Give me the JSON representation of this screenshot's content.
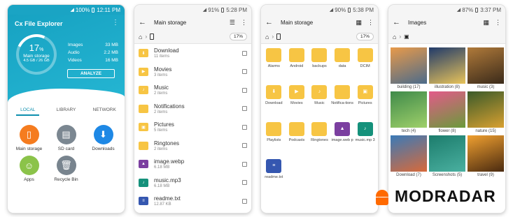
{
  "status": [
    {
      "battery": "100%",
      "time": "12:11 PM"
    },
    {
      "battery": "91%",
      "time": "5:28 PM"
    },
    {
      "battery": "90%",
      "time": "5:38 PM"
    },
    {
      "battery": "87%",
      "time": "3:37 PM"
    }
  ],
  "home": {
    "app_title": "Cx File Explorer",
    "percent": "17",
    "percent_sign": "%",
    "storage_label": "Main storage",
    "storage_size": "4.5 GB / 26 GB",
    "usage_progress": 0.17,
    "stats": [
      {
        "label": "Images",
        "value": "33 MB"
      },
      {
        "label": "Audio",
        "value": "2.2 MB"
      },
      {
        "label": "Videos",
        "value": "16 MB"
      }
    ],
    "analyze_label": "ANALYZE",
    "tabs": [
      "LOCAL",
      "LIBRARY",
      "NETWORK"
    ],
    "categories": [
      {
        "label": "Main storage",
        "color": "#f57c1f",
        "icon": "phone-icon"
      },
      {
        "label": "SD card",
        "color": "#7b8791",
        "icon": "sd-card-icon"
      },
      {
        "label": "Downloads",
        "color": "#1e88e5",
        "icon": "download-icon"
      },
      {
        "label": "Apps",
        "color": "#8bc34a",
        "icon": "android-icon"
      },
      {
        "label": "Recycle Bin",
        "color": "#78848e",
        "icon": "trash-icon"
      }
    ]
  },
  "list_view": {
    "title": "Main storage",
    "usage_chip": "17%",
    "items": [
      {
        "name": "Download",
        "sub": "11 items",
        "icon": "download-folder-icon"
      },
      {
        "name": "Movies",
        "sub": "3 items",
        "icon": "movies-folder-icon"
      },
      {
        "name": "Music",
        "sub": "2 items",
        "icon": "music-folder-icon"
      },
      {
        "name": "Notifications",
        "sub": "2 items",
        "icon": "folder-icon"
      },
      {
        "name": "Pictures",
        "sub": "5 items",
        "icon": "pictures-folder-icon"
      },
      {
        "name": "Ringtones",
        "sub": "2 items",
        "icon": "folder-icon"
      },
      {
        "name": "image.webp",
        "sub": "6.18 MB",
        "icon": "image-file-icon"
      },
      {
        "name": "music.mp3",
        "sub": "6.18 MB",
        "icon": "audio-file-icon"
      },
      {
        "name": "readme.txt",
        "sub": "12.87 KB",
        "icon": "text-file-icon"
      }
    ]
  },
  "grid_view": {
    "title": "Main storage",
    "usage_chip": "17%",
    "items": [
      {
        "name": "Alarms",
        "kind": "folder"
      },
      {
        "name": "Android",
        "kind": "folder"
      },
      {
        "name": "backups",
        "kind": "folder"
      },
      {
        "name": "data",
        "kind": "folder"
      },
      {
        "name": "DCIM",
        "kind": "folder"
      },
      {
        "name": "Download",
        "kind": "folder",
        "glyph": "⬇"
      },
      {
        "name": "Movies",
        "kind": "folder",
        "glyph": "▶"
      },
      {
        "name": "Music",
        "kind": "folder",
        "glyph": "♪"
      },
      {
        "name": "Notifica-tions",
        "kind": "folder"
      },
      {
        "name": "Pictures",
        "kind": "folder",
        "glyph": "▣"
      },
      {
        "name": "Playlists",
        "kind": "folder"
      },
      {
        "name": "Podcasts",
        "kind": "folder"
      },
      {
        "name": "Ringtones",
        "kind": "folder"
      },
      {
        "name": "image.web p",
        "kind": "image"
      },
      {
        "name": "music.mp 3",
        "kind": "audio"
      },
      {
        "name": "readme.txt",
        "kind": "text"
      }
    ]
  },
  "images_view": {
    "title": "Images",
    "items": [
      {
        "label": "building (17)",
        "colors": [
          "#e89a4a",
          "#4c6b8a"
        ]
      },
      {
        "label": "illustration (8)",
        "colors": [
          "#203a6a",
          "#e8c35a"
        ]
      },
      {
        "label": "music (3)",
        "colors": [
          "#b07a3a",
          "#3a2a1a"
        ]
      },
      {
        "label": "tech (4)",
        "colors": [
          "#3f8a4a",
          "#9fd06a"
        ]
      },
      {
        "label": "flower (8)",
        "colors": [
          "#e35a8a",
          "#6a9a3a"
        ]
      },
      {
        "label": "nature (15)",
        "colors": [
          "#3a5a2a",
          "#d8a030"
        ]
      },
      {
        "label": "Download (7)",
        "colors": [
          "#3a7ab8",
          "#d86a3a"
        ]
      },
      {
        "label": "Screenshots (5)",
        "colors": [
          "#1c7c6c",
          "#4ab0a0"
        ]
      },
      {
        "label": "travel (9)",
        "colors": [
          "#f0a030",
          "#4a2a10"
        ]
      }
    ]
  },
  "watermark": "MODRADAR"
}
